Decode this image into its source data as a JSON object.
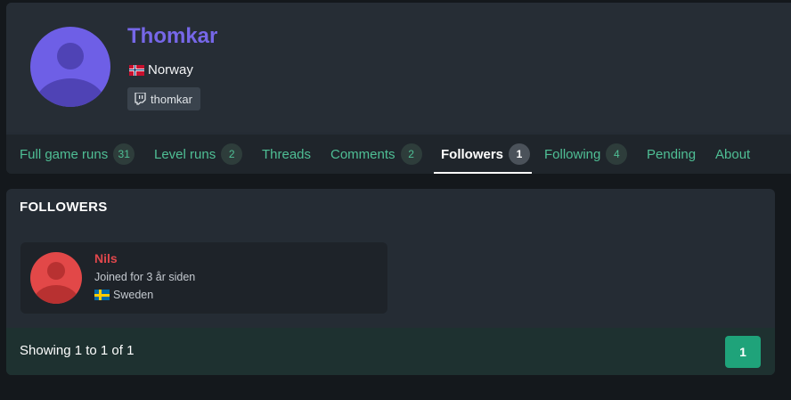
{
  "profile": {
    "username": "Thomkar",
    "country": "Norway",
    "twitch_handle": "thomkar"
  },
  "tabs": [
    {
      "label": "Full game runs",
      "count": "31"
    },
    {
      "label": "Level runs",
      "count": "2"
    },
    {
      "label": "Threads"
    },
    {
      "label": "Comments",
      "count": "2"
    },
    {
      "label": "Followers",
      "count": "1",
      "active": true
    },
    {
      "label": "Following",
      "count": "4"
    },
    {
      "label": "Pending"
    },
    {
      "label": "About"
    }
  ],
  "followers_section": {
    "title": "FOLLOWERS",
    "followers": [
      {
        "name": "Nils",
        "joined": "Joined for 3 år siden",
        "country": "Sweden"
      }
    ],
    "showing": "Showing 1 to 1 of 1",
    "page": "1"
  },
  "colors": {
    "accent_green": "#4fbf95",
    "username_purple": "#7667e8",
    "follower_name_red": "#e0474c",
    "page_button": "#1fa37a"
  }
}
